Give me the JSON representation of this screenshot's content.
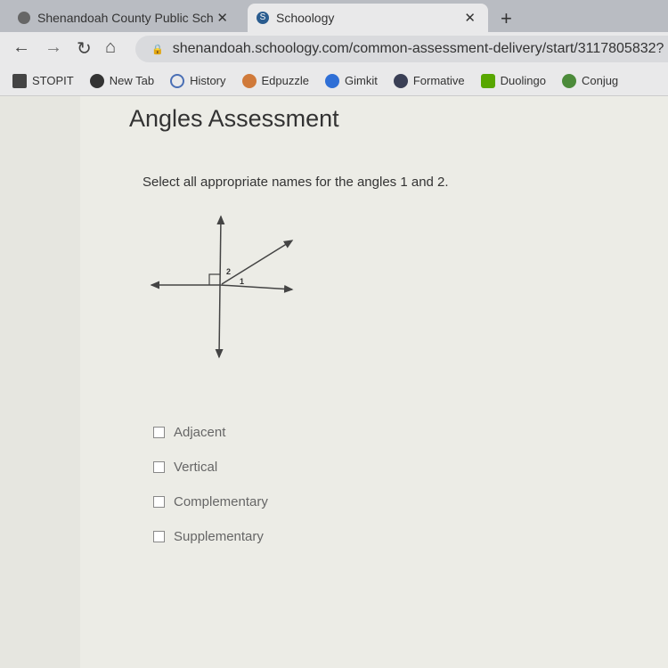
{
  "browser": {
    "tabs": [
      {
        "label": "Shenandoah County Public Sch",
        "icon": "link-icon",
        "active": false
      },
      {
        "label": "Schoology",
        "icon": "schoology-icon",
        "active": true
      }
    ],
    "url": "shenandoah.schoology.com/common-assessment-delivery/start/3117805832?",
    "bookmarks": [
      {
        "label": "STOPIT",
        "color": "#444444"
      },
      {
        "label": "New Tab",
        "color": "#333333"
      },
      {
        "label": "History",
        "color": "#4a6fb5"
      },
      {
        "label": "Edpuzzle",
        "color": "#d07a3a"
      },
      {
        "label": "Gimkit",
        "color": "#2f6fd6"
      },
      {
        "label": "Formative",
        "color": "#3a3f55"
      },
      {
        "label": "Duolingo",
        "color": "#58a700"
      },
      {
        "label": "Conjug",
        "color": "#4c8b3a"
      }
    ]
  },
  "assessment": {
    "title": "Angles Assessment",
    "question": "Select all appropriate names for the angles 1 and 2.",
    "figure_labels": {
      "angle1": "1",
      "angle2": "2"
    },
    "options": [
      {
        "label": "Adjacent",
        "checked": false
      },
      {
        "label": "Vertical",
        "checked": false
      },
      {
        "label": "Complementary",
        "checked": false
      },
      {
        "label": "Supplementary",
        "checked": false
      }
    ]
  }
}
